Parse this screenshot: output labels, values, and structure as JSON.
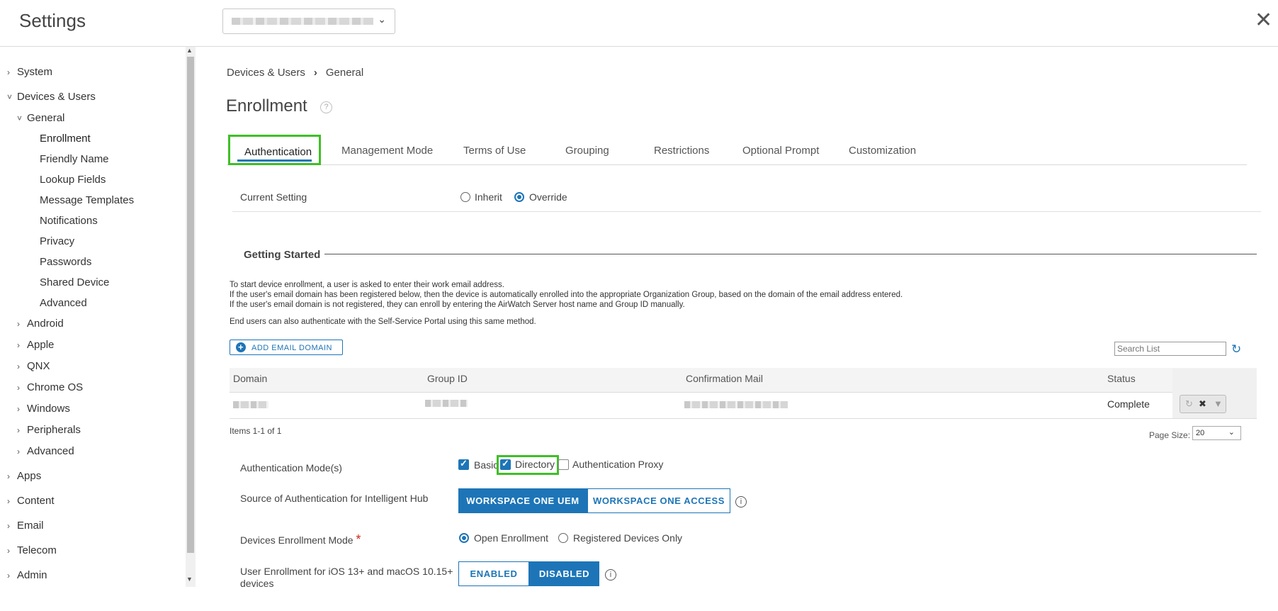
{
  "header": {
    "title": "Settings",
    "close_glyph": "✕"
  },
  "sidebar": {
    "items": [
      {
        "label": "System",
        "chevron": "›"
      },
      {
        "label": "Devices & Users",
        "chevron": "˅"
      },
      {
        "label": "General",
        "chevron": "˅"
      },
      {
        "label": "Enrollment"
      },
      {
        "label": "Friendly Name"
      },
      {
        "label": "Lookup Fields"
      },
      {
        "label": "Message Templates"
      },
      {
        "label": "Notifications"
      },
      {
        "label": "Privacy"
      },
      {
        "label": "Passwords"
      },
      {
        "label": "Shared Device"
      },
      {
        "label": "Advanced"
      },
      {
        "label": "Android",
        "chevron": "›"
      },
      {
        "label": "Apple",
        "chevron": "›"
      },
      {
        "label": "QNX",
        "chevron": "›"
      },
      {
        "label": "Chrome OS",
        "chevron": "›"
      },
      {
        "label": "Windows",
        "chevron": "›"
      },
      {
        "label": "Peripherals",
        "chevron": "›"
      },
      {
        "label": "Advanced",
        "chevron": "›"
      },
      {
        "label": "Apps",
        "chevron": "›"
      },
      {
        "label": "Content",
        "chevron": "›"
      },
      {
        "label": "Email",
        "chevron": "›"
      },
      {
        "label": "Telecom",
        "chevron": "›"
      },
      {
        "label": "Admin",
        "chevron": "›"
      }
    ]
  },
  "breadcrumb": {
    "parent": "Devices & Users",
    "separator": "›",
    "current": "General"
  },
  "page": {
    "title": "Enrollment",
    "help_glyph": "?"
  },
  "tabs": [
    "Authentication",
    "Management Mode",
    "Terms of Use",
    "Grouping",
    "Restrictions",
    "Optional Prompt",
    "Customization"
  ],
  "current_setting": {
    "label": "Current Setting",
    "options": [
      "Inherit",
      "Override"
    ],
    "selected": "Override"
  },
  "getting_started": {
    "title": "Getting Started",
    "lines": [
      "To start device enrollment, a user is asked to enter their work email address.",
      "If the user's email domain has been registered below, then the device is automatically enrolled into the appropriate Organization Group, based on the domain of the email address entered.",
      "If the user's email domain is not registered, they can enroll by entering the AirWatch Server host name and Group ID manually.",
      "End users can also authenticate with the Self-Service Portal using this same method."
    ]
  },
  "domain_table": {
    "add_button": "ADD EMAIL DOMAIN",
    "search_placeholder": "Search List",
    "columns": [
      "Domain",
      "Group ID",
      "Confirmation Mail",
      "Status"
    ],
    "rows": [
      {
        "status": "Complete"
      }
    ],
    "items_label": "Items 1-1 of 1",
    "page_size_label": "Page Size:",
    "page_size": "20"
  },
  "auth_modes": {
    "label": "Authentication Mode(s)",
    "options": [
      {
        "label": "Basic",
        "checked": true
      },
      {
        "label": "Directory",
        "checked": true
      },
      {
        "label": "Authentication Proxy",
        "checked": false
      }
    ]
  },
  "auth_source": {
    "label": "Source of Authentication for Intelligent Hub",
    "options": [
      "WORKSPACE ONE UEM",
      "WORKSPACE ONE ACCESS"
    ],
    "selected": "WORKSPACE ONE UEM"
  },
  "enrollment_mode": {
    "label": "Devices Enrollment Mode",
    "required_mark": "*",
    "options": [
      "Open Enrollment",
      "Registered Devices Only"
    ],
    "selected": "Open Enrollment"
  },
  "user_enrollment": {
    "label_line1": "User Enrollment for iOS 13+ and macOS 10.15+",
    "label_line2": "devices",
    "options": [
      "ENABLED",
      "DISABLED"
    ],
    "selected": "DISABLED"
  },
  "colors": {
    "accent": "#1d75b7",
    "highlight": "#3fbf27",
    "required": "#d0271d"
  },
  "icons": {
    "info": "i",
    "refresh": "↻",
    "plus": "+",
    "chevron_down": "⌄"
  }
}
